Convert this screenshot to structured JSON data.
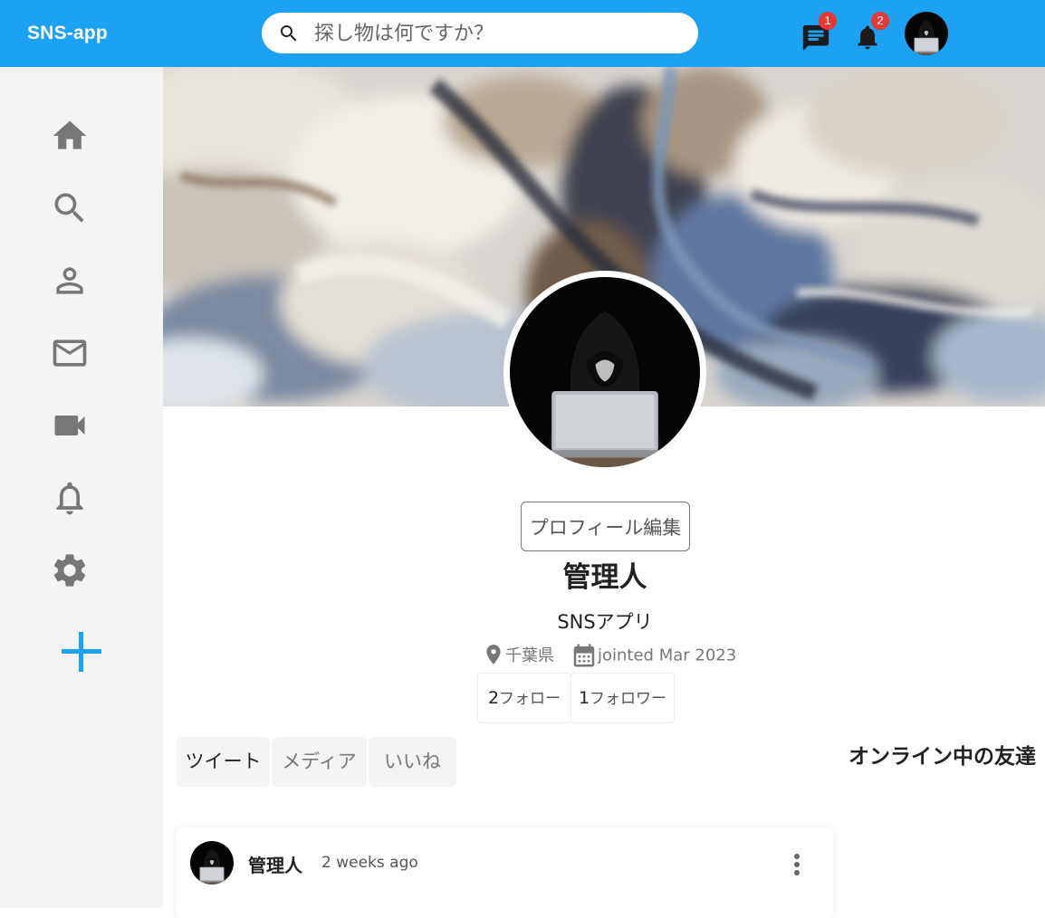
{
  "app": {
    "brand": "SNS-app"
  },
  "search": {
    "placeholder": "探し物は何ですか？",
    "value": ""
  },
  "header": {
    "messages_badge": "1",
    "notifications_badge": "2"
  },
  "sidebar": {
    "items": [
      {
        "icon": "home-icon"
      },
      {
        "icon": "search-icon"
      },
      {
        "icon": "person-icon"
      },
      {
        "icon": "mail-icon"
      },
      {
        "icon": "video-icon"
      },
      {
        "icon": "bell-icon"
      },
      {
        "icon": "gear-icon"
      },
      {
        "icon": "plus-icon"
      }
    ]
  },
  "profile": {
    "edit_label": "プロフィール編集",
    "name": "管理人",
    "bio": "SNSアプリ",
    "location": "千葉県",
    "joined": "jointed Mar 2023",
    "following_count": "2",
    "following_label": "フォロー",
    "followers_count": "1",
    "followers_label": "フォロワー"
  },
  "tabs": [
    {
      "label": "ツイート",
      "active": true
    },
    {
      "label": "メディア",
      "active": false
    },
    {
      "label": "いいね",
      "active": false
    }
  ],
  "right_panel": {
    "title": "オンライン中の友達"
  },
  "posts": [
    {
      "author": "管理人",
      "time": "2 weeks ago"
    }
  ],
  "colors": {
    "accent": "#1da1f2",
    "badge": "#e53935",
    "sidebar_bg": "#f4f4f4",
    "icon_gray": "#777777",
    "plus": "#1da1f2"
  }
}
